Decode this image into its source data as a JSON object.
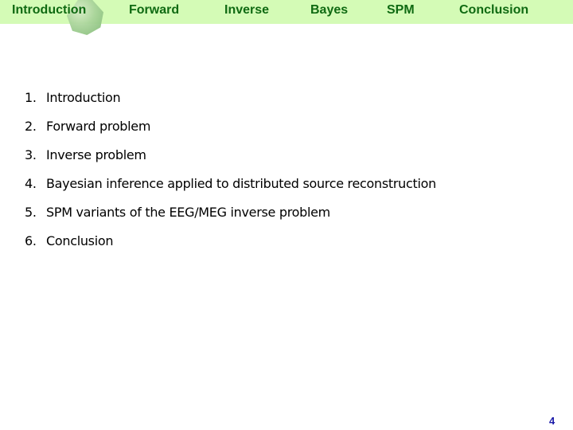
{
  "nav": {
    "items": [
      {
        "label": "Introduction",
        "active": true
      },
      {
        "label": "Forward"
      },
      {
        "label": "Inverse"
      },
      {
        "label": "Bayes"
      },
      {
        "label": "SPM"
      },
      {
        "label": "Conclusion"
      }
    ]
  },
  "outline": {
    "items": [
      {
        "num": "1.",
        "text": "Introduction"
      },
      {
        "num": "2.",
        "text": "Forward problem"
      },
      {
        "num": "3.",
        "text": "Inverse problem"
      },
      {
        "num": "4.",
        "text": "Bayesian inference applied to distributed source reconstruction"
      },
      {
        "num": "5.",
        "text": "SPM variants of the EEG/MEG inverse problem"
      },
      {
        "num": "6.",
        "text": "Conclusion"
      }
    ]
  },
  "footer": {
    "page_number": "4"
  },
  "colors": {
    "nav_bg": "#d4fbb6",
    "nav_text": "#0f6a12",
    "page_number": "#1a1aa8"
  }
}
